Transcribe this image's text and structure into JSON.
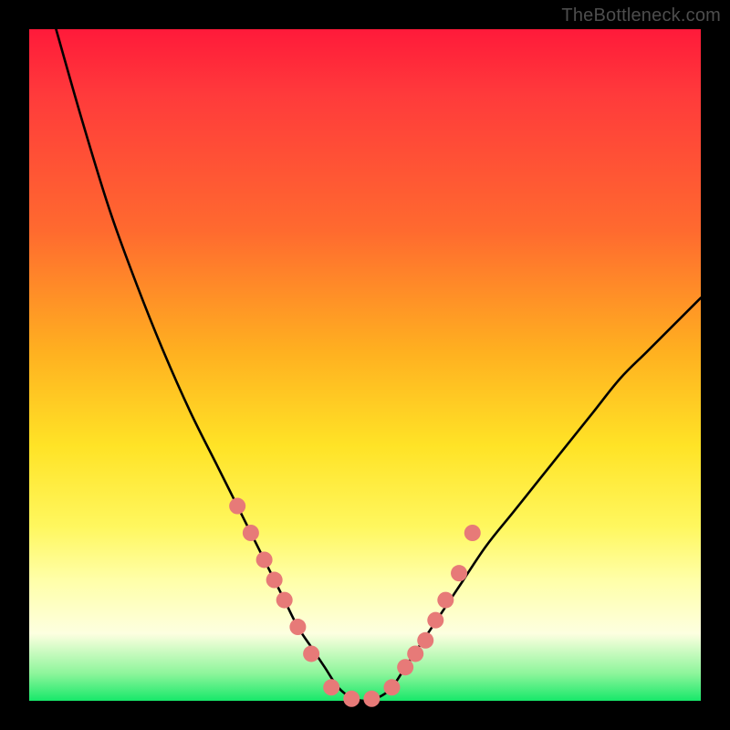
{
  "watermark": "TheBottleneck.com",
  "colors": {
    "background_frame": "#000000",
    "gradient_top": "#ff1a3a",
    "gradient_bottom": "#17e86a",
    "curve_stroke": "#000000",
    "marker_fill": "#e77a78",
    "marker_stroke": "#c94f4f"
  },
  "chart_data": {
    "type": "line",
    "title": "",
    "xlabel": "",
    "ylabel": "",
    "xlim": [
      0,
      100
    ],
    "ylim": [
      0,
      100
    ],
    "grid": false,
    "notes": "V-shaped bottleneck curve on rainbow heat gradient. Axes unlabeled; values are estimated percentages of plot area. y=0 at bottom; minimum (≈0) near x≈45–52. Left arm rises very steeply to y≈100 at x≈4; right arm rises more gradually to y≈60 at x=100.",
    "series": [
      {
        "name": "bottleneck-curve",
        "x": [
          4,
          8,
          12,
          16,
          20,
          24,
          28,
          31,
          34,
          36,
          38,
          40,
          42,
          44,
          46,
          48,
          50,
          52,
          54,
          56,
          58,
          60,
          64,
          68,
          72,
          76,
          80,
          84,
          88,
          92,
          96,
          100
        ],
        "y": [
          100,
          86,
          73,
          62,
          52,
          43,
          35,
          29,
          23,
          19,
          15,
          11,
          8,
          5,
          2,
          0.5,
          0,
          0.5,
          2,
          5,
          8,
          11,
          17,
          23,
          28,
          33,
          38,
          43,
          48,
          52,
          56,
          60
        ]
      }
    ],
    "markers": {
      "name": "highlighted-points",
      "comment": "Salmon dots clustered along both arms near the trough (roughly y 6–30).",
      "x": [
        31,
        33,
        35,
        36.5,
        38,
        40,
        42,
        45,
        48,
        51,
        54,
        56,
        57.5,
        59,
        60.5,
        62,
        64,
        66
      ],
      "y": [
        29,
        25,
        21,
        18,
        15,
        11,
        7,
        2,
        0.3,
        0.3,
        2,
        5,
        7,
        9,
        12,
        15,
        19,
        25
      ]
    }
  }
}
